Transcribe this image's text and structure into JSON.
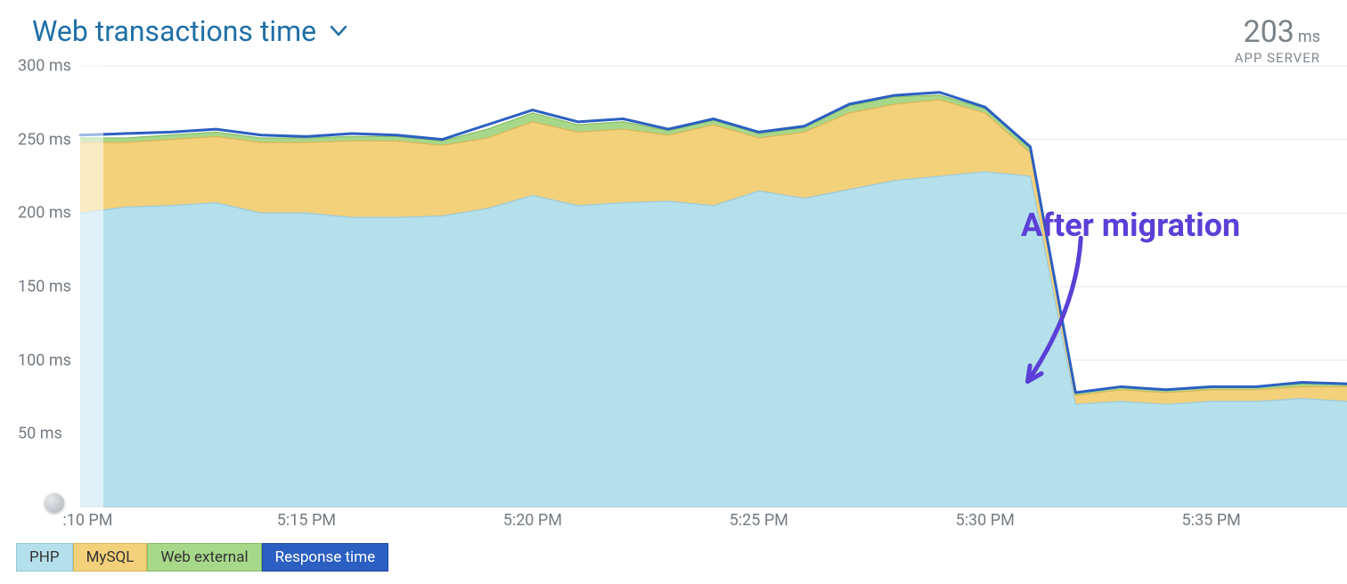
{
  "header": {
    "title": "Web transactions time",
    "metric_value": "203",
    "metric_unit": "ms",
    "metric_subtitle": "APP SERVER"
  },
  "y_axis": {
    "unit": "ms",
    "min": 0,
    "max": 300,
    "ticks": [
      50,
      100,
      150,
      200,
      250,
      300
    ]
  },
  "x_axis": {
    "ticks": [
      ":10 PM",
      "5:15 PM",
      "5:20 PM",
      "5:25 PM",
      "5:30 PM",
      "5:35 PM"
    ]
  },
  "legend": {
    "items": [
      {
        "key": "php",
        "label": "PHP",
        "color": "#b4e0eb"
      },
      {
        "key": "mysql",
        "label": "MySQL",
        "color": "#f3d07a"
      },
      {
        "key": "webex",
        "label": "Web external",
        "color": "#a7d88a"
      },
      {
        "key": "resp",
        "label": "Response time",
        "color": "#2b5fc1"
      }
    ]
  },
  "annotation": {
    "text": "After migration",
    "arrow_from_rel": [
      0.8,
      0.4
    ],
    "arrow_to_rel": [
      0.76,
      0.72
    ],
    "text_pos_rel": [
      0.755,
      0.33
    ]
  },
  "chart_data": {
    "type": "area",
    "xlabel": "",
    "ylabel": "",
    "ylim": [
      0,
      300
    ],
    "y_unit": "ms",
    "x": [
      "5:10",
      "5:11",
      "5:12",
      "5:13",
      "5:14",
      "5:15",
      "5:16",
      "5:17",
      "5:18",
      "5:19",
      "5:20",
      "5:21",
      "5:22",
      "5:23",
      "5:24",
      "5:25",
      "5:26",
      "5:27",
      "5:28",
      "5:29",
      "5:30",
      "5:31",
      "5:32",
      "5:33",
      "5:34",
      "5:35",
      "5:36",
      "5:37",
      "5:38"
    ],
    "series": [
      {
        "name": "PHP",
        "color": "#b4e0eb",
        "values": [
          200,
          204,
          205,
          207,
          200,
          200,
          197,
          197,
          198,
          203,
          212,
          205,
          207,
          208,
          205,
          215,
          210,
          216,
          222,
          225,
          228,
          225,
          70,
          72,
          70,
          72,
          72,
          74,
          72
        ]
      },
      {
        "name": "MySQL",
        "color": "#f3d07a",
        "values": [
          48,
          44,
          45,
          45,
          48,
          48,
          52,
          52,
          48,
          48,
          50,
          50,
          50,
          45,
          55,
          36,
          45,
          52,
          52,
          52,
          40,
          16,
          6,
          8,
          8,
          8,
          8,
          8,
          10
        ]
      },
      {
        "name": "Web external",
        "color": "#a7d88a",
        "values": [
          3,
          3,
          3,
          3,
          3,
          3,
          3,
          3,
          3,
          6,
          6,
          5,
          5,
          3,
          3,
          3,
          3,
          5,
          5,
          3,
          3,
          3,
          2,
          2,
          2,
          2,
          2,
          2,
          2
        ]
      },
      {
        "name": "Response time",
        "color": "#2b5fc1",
        "is_line": true,
        "values": [
          253,
          254,
          255,
          257,
          253,
          252,
          254,
          253,
          250,
          260,
          270,
          262,
          264,
          257,
          264,
          255,
          259,
          274,
          280,
          282,
          272,
          245,
          78,
          82,
          80,
          82,
          82,
          85,
          84
        ]
      }
    ],
    "x_tick_labels": [
      ":10 PM",
      "5:15 PM",
      "5:20 PM",
      "5:25 PM",
      "5:30 PM",
      "5:35 PM"
    ],
    "y_tick_labels": [
      "50 ms",
      "100 ms",
      "150 ms",
      "200 ms",
      "250 ms",
      "300 ms"
    ],
    "migration_index": 22,
    "annotation": "After migration"
  },
  "colors": {
    "title": "#1f6fa6",
    "grid": "#d4d7da",
    "response_line": "#2b5fc1",
    "php_fill": "#b4e0eb",
    "mysql_fill": "#f3d07a",
    "webex_fill": "#a7d88a",
    "annotation": "#5b3fd6"
  }
}
